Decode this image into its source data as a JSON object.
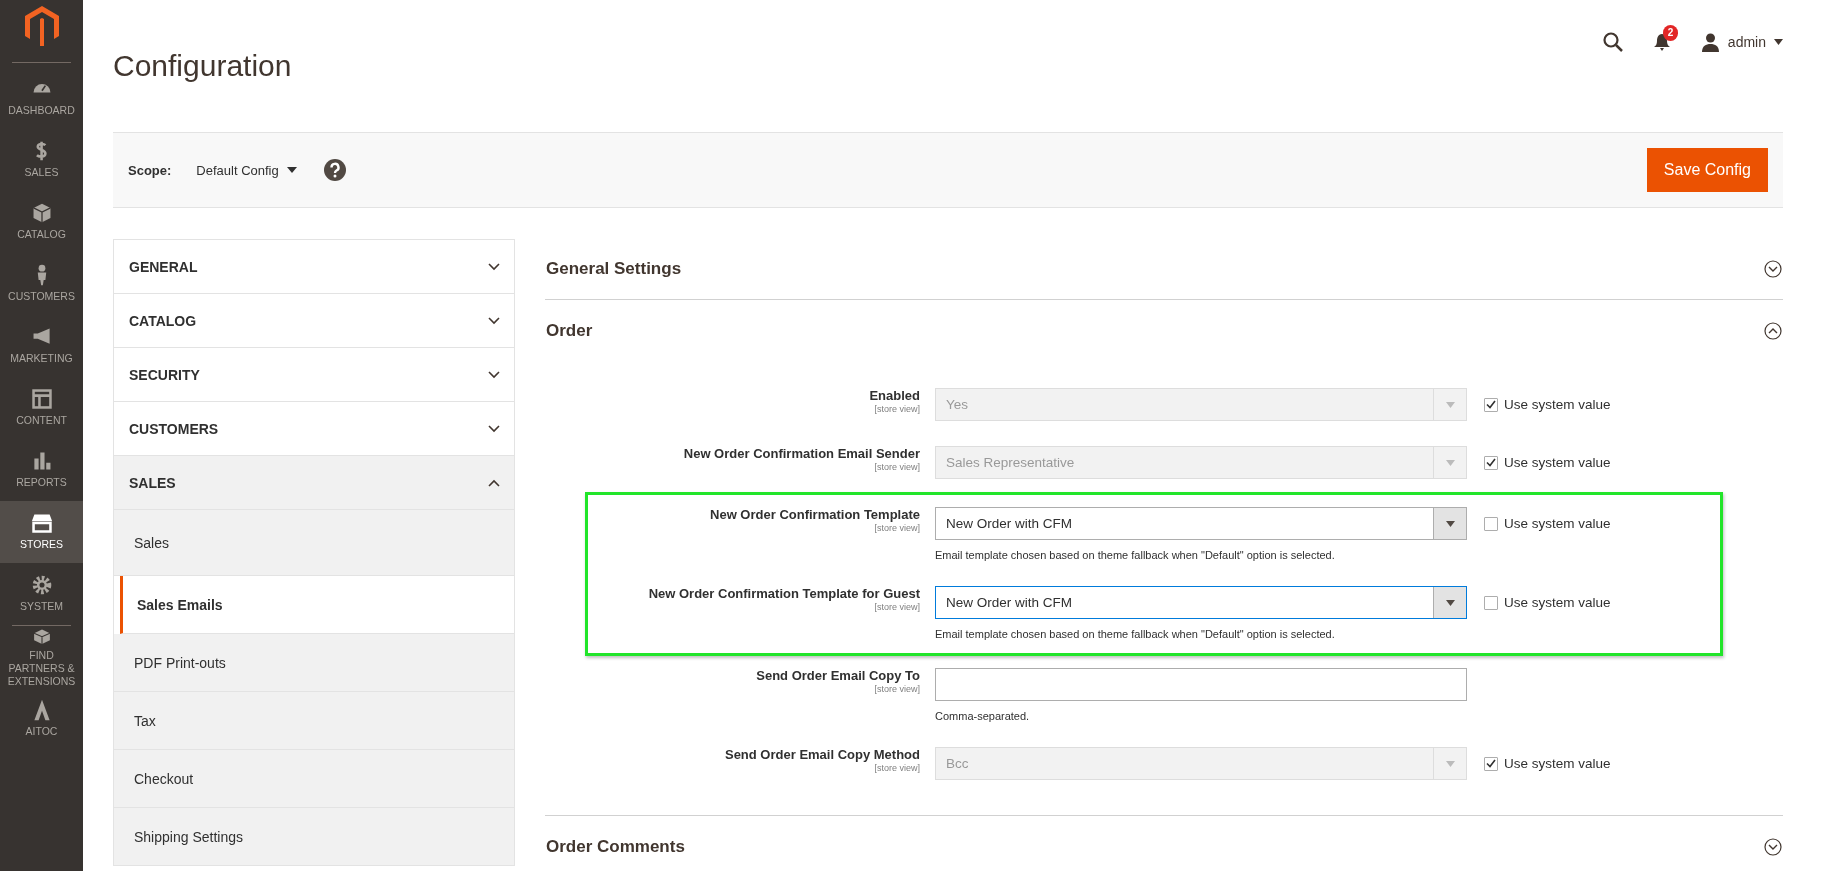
{
  "sidebar": {
    "items": [
      {
        "label": "DASHBOARD",
        "selected": false
      },
      {
        "label": "SALES",
        "selected": false
      },
      {
        "label": "CATALOG",
        "selected": false
      },
      {
        "label": "CUSTOMERS",
        "selected": false
      },
      {
        "label": "MARKETING",
        "selected": false
      },
      {
        "label": "CONTENT",
        "selected": false
      },
      {
        "label": "REPORTS",
        "selected": false
      },
      {
        "label": "STORES",
        "selected": true
      },
      {
        "label": "SYSTEM",
        "selected": false
      },
      {
        "label": "FIND PARTNERS & EXTENSIONS",
        "selected": false
      },
      {
        "label": "AITOC",
        "selected": false
      }
    ]
  },
  "header": {
    "title": "Configuration",
    "notification_count": "2",
    "user": "admin"
  },
  "scope": {
    "label": "Scope:",
    "value": "Default Config"
  },
  "save_button": "Save Config",
  "nav": [
    {
      "label": "GENERAL",
      "expanded": false
    },
    {
      "label": "CATALOG",
      "expanded": false
    },
    {
      "label": "SECURITY",
      "expanded": false
    },
    {
      "label": "CUSTOMERS",
      "expanded": false
    },
    {
      "label": "SALES",
      "expanded": true,
      "children": [
        {
          "label": "Sales",
          "selected": false
        },
        {
          "label": "Sales Emails",
          "selected": true
        },
        {
          "label": "PDF Print-outs",
          "selected": false
        },
        {
          "label": "Tax",
          "selected": false
        },
        {
          "label": "Checkout",
          "selected": false
        },
        {
          "label": "Shipping Settings",
          "selected": false
        }
      ]
    }
  ],
  "sections": [
    {
      "title": "General Settings",
      "expanded": false
    },
    {
      "title": "Order",
      "expanded": true,
      "fields": [
        {
          "label": "Enabled",
          "scope": "[store view]",
          "kind": "select",
          "value": "Yes",
          "disabled": true,
          "highlighted": false,
          "use_system_value": {
            "label": "Use system value",
            "checked": true
          }
        },
        {
          "label": "New Order Confirmation Email Sender",
          "scope": "[store view]",
          "kind": "select",
          "value": "Sales Representative",
          "disabled": true,
          "highlighted": false,
          "use_system_value": {
            "label": "Use system value",
            "checked": true
          }
        },
        {
          "label": "New Order Confirmation Template",
          "scope": "[store view]",
          "kind": "select",
          "value": "New Order with CFM",
          "disabled": false,
          "focused": false,
          "highlighted": true,
          "note": "Email template chosen based on theme fallback when \"Default\" option is selected.",
          "use_system_value": {
            "label": "Use system value",
            "checked": false
          }
        },
        {
          "label": "New Order Confirmation Template for Guest",
          "scope": "[store view]",
          "kind": "select",
          "value": "New Order with CFM",
          "disabled": false,
          "focused": true,
          "highlighted": true,
          "note": "Email template chosen based on theme fallback when \"Default\" option is selected.",
          "use_system_value": {
            "label": "Use system value",
            "checked": false
          }
        },
        {
          "label": "Send Order Email Copy To",
          "scope": "[store view]",
          "kind": "text",
          "disabled": false,
          "highlighted": false,
          "note": "Comma-separated."
        },
        {
          "label": "Send Order Email Copy Method",
          "scope": "[store view]",
          "kind": "select",
          "value": "Bcc",
          "disabled": true,
          "highlighted": false,
          "use_system_value": {
            "label": "Use system value",
            "checked": true
          }
        }
      ]
    },
    {
      "title": "Order Comments",
      "expanded": false
    }
  ]
}
